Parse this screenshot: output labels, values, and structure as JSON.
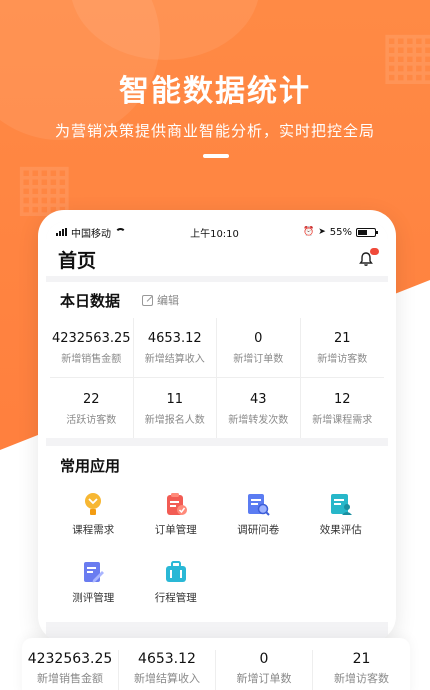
{
  "hero": {
    "headline": "智能数据统计",
    "subline": "为营销决策提供商业智能分析，实时把控全局",
    "accent": "#ff7a3a"
  },
  "statusbar": {
    "carrier": "中国移动",
    "time": "上午10:10",
    "battery": "55%",
    "battery_level": 0.55
  },
  "header": {
    "title": "首页"
  },
  "today": {
    "title": "本日数据",
    "edit_label": "编辑",
    "stats": [
      {
        "value": "4232563.25",
        "label": "新增销售金额"
      },
      {
        "value": "4653.12",
        "label": "新增结算收入"
      },
      {
        "value": "0",
        "label": "新增订单数"
      },
      {
        "value": "21",
        "label": "新增访客数"
      },
      {
        "value": "22",
        "label": "活跃访客数"
      },
      {
        "value": "11",
        "label": "新增报名人数"
      },
      {
        "value": "43",
        "label": "新增转发次数"
      },
      {
        "value": "12",
        "label": "新增课程需求"
      }
    ]
  },
  "apps": {
    "title": "常用应用",
    "items": [
      {
        "label": "课程需求",
        "icon": "trophy-icon",
        "color": "#f5a623"
      },
      {
        "label": "订单管理",
        "icon": "clipboard-check-icon",
        "color": "#f25c54"
      },
      {
        "label": "调研问卷",
        "icon": "survey-search-icon",
        "color": "#5b7cf2"
      },
      {
        "label": "效果评估",
        "icon": "user-report-icon",
        "color": "#27b7c9"
      },
      {
        "label": "测评管理",
        "icon": "edit-doc-icon",
        "color": "#6a7cf0"
      },
      {
        "label": "行程管理",
        "icon": "luggage-icon",
        "color": "#2ab8d6"
      }
    ]
  },
  "bottom": {
    "stats": [
      {
        "value": "4232563.25",
        "label": "新增销售金额"
      },
      {
        "value": "4653.12",
        "label": "新增结算收入"
      },
      {
        "value": "0",
        "label": "新增订单数"
      },
      {
        "value": "21",
        "label": "新增访客数"
      }
    ]
  }
}
